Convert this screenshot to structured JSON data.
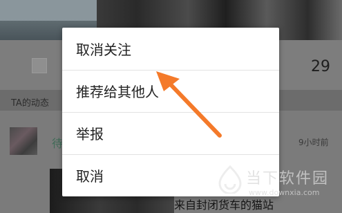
{
  "profile": {
    "follow_count": "29"
  },
  "section": {
    "title": "TA的动态"
  },
  "feed": {
    "name": "待",
    "time": "9小时前",
    "caption": "来自封闭货车的猫站"
  },
  "menu": {
    "items": [
      "取消关注",
      "推荐给其他人",
      "举报",
      "取消"
    ]
  },
  "watermark": {
    "brand": "当下软件园",
    "url": "www.downxia.com"
  },
  "colors": {
    "arrow": "#F47A2A",
    "menu_bg": "#FFFFFF",
    "overlay": "#7A7A7A"
  }
}
